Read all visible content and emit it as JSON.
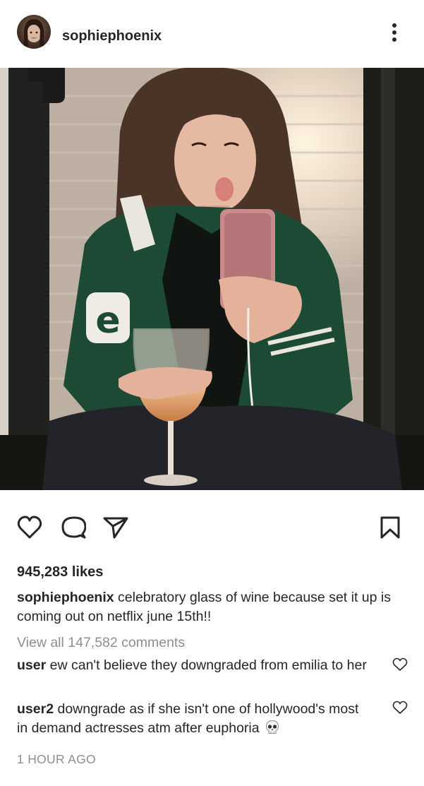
{
  "post": {
    "username": "sophiephoenix",
    "likes_text": "945,283 likes",
    "caption": {
      "username": "sophiephoenix",
      "text": "celebratory glass of wine because set it up is coming out on netflix june 15th!!"
    },
    "view_all_comments": "View all 147,582 comments",
    "comments": [
      {
        "username": "user",
        "text": "ew can't believe they downgraded from emilia to her"
      },
      {
        "username": "user2",
        "text": "downgrade as if she isn't one of hollywood's most in demand actresses atm after euphoria",
        "emoji": "skull-icon"
      }
    ],
    "timestamp": "1 HOUR AGO"
  },
  "icons": {
    "menu": "more-vertical-icon",
    "like": "heart-icon",
    "comment": "comment-bubble-icon",
    "share": "paper-plane-icon",
    "save": "bookmark-icon"
  },
  "colors": {
    "text": "#262626",
    "muted": "#8e8e8e",
    "background": "#ffffff"
  }
}
